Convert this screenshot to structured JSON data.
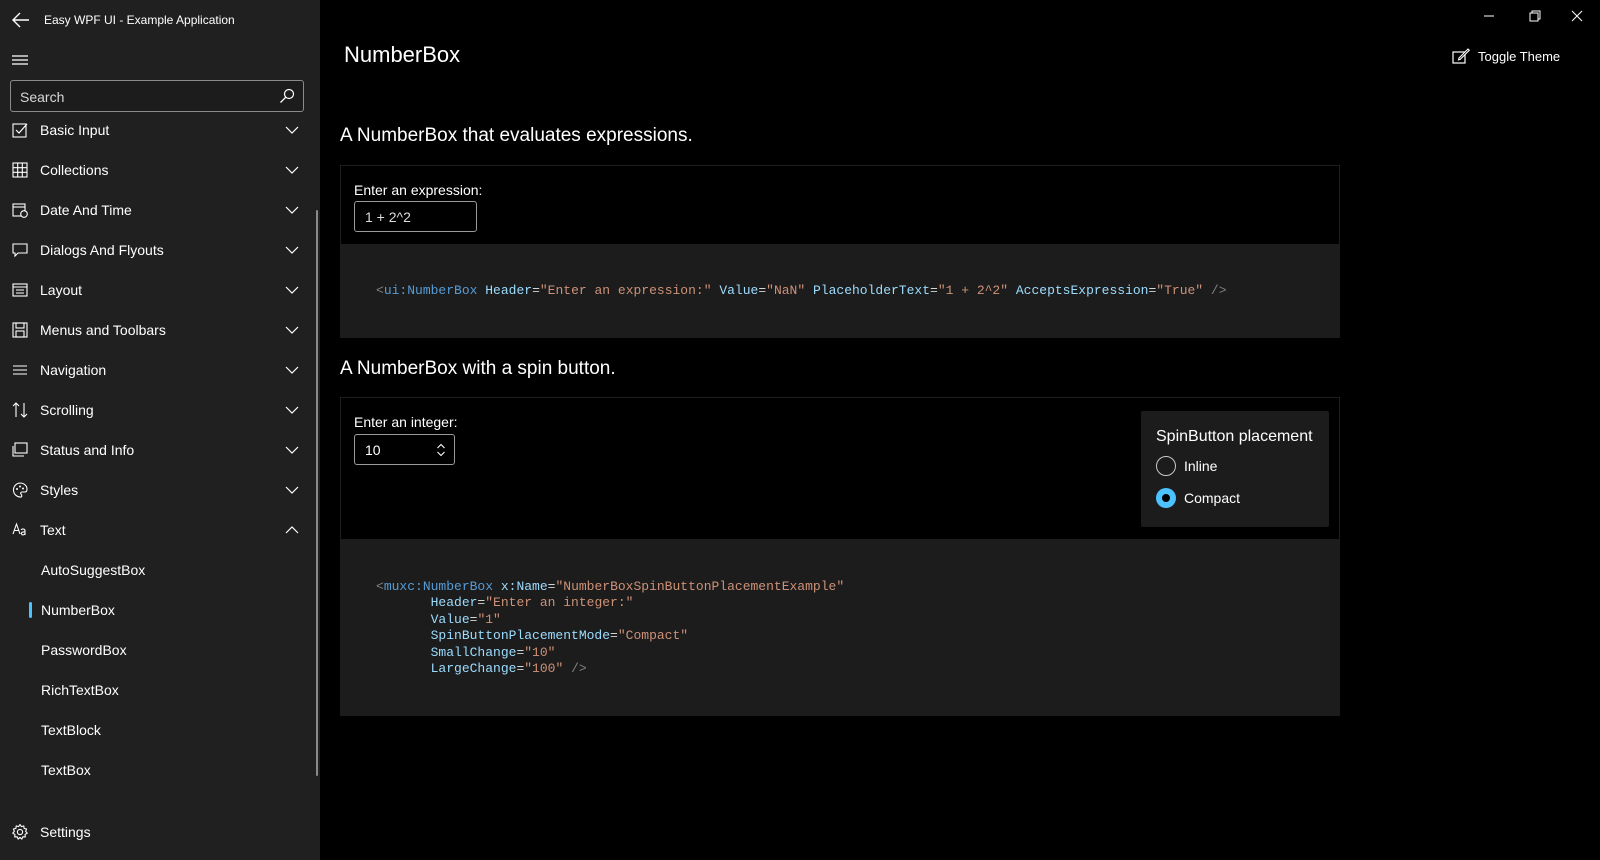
{
  "app": {
    "title": "Easy WPF UI - Example Application"
  },
  "search": {
    "placeholder": "Search"
  },
  "sidebar": {
    "items": [
      {
        "label": "Basic Input",
        "icon": "checkbox-icon",
        "expanded": false
      },
      {
        "label": "Collections",
        "icon": "grid-icon",
        "expanded": false
      },
      {
        "label": "Date And Time",
        "icon": "calendar-icon",
        "expanded": false
      },
      {
        "label": "Dialogs And Flyouts",
        "icon": "chat-icon",
        "expanded": false
      },
      {
        "label": "Layout",
        "icon": "layout-icon",
        "expanded": false
      },
      {
        "label": "Menus and Toolbars",
        "icon": "save-icon",
        "expanded": false
      },
      {
        "label": "Navigation",
        "icon": "list-icon",
        "expanded": false
      },
      {
        "label": "Scrolling",
        "icon": "arrows-icon",
        "expanded": false
      },
      {
        "label": "Status and Info",
        "icon": "status-icon",
        "expanded": false
      },
      {
        "label": "Styles",
        "icon": "palette-icon",
        "expanded": false
      },
      {
        "label": "Text",
        "icon": "text-icon",
        "expanded": true
      }
    ],
    "sub_items": [
      "AutoSuggestBox",
      "NumberBox",
      "PasswordBox",
      "RichTextBox",
      "TextBlock",
      "TextBox"
    ],
    "selected_sub_item": "NumberBox",
    "settings_label": "Settings"
  },
  "page": {
    "title": "NumberBox",
    "toggle_theme_label": "Toggle Theme"
  },
  "example1": {
    "title": "A NumberBox that evaluates expressions.",
    "field_label": "Enter an expression:",
    "placeholder": "1 + 2^2",
    "value": "",
    "code": [
      [
        [
          "t-gray",
          "<"
        ],
        [
          "t-tag",
          "ui:NumberBox"
        ],
        [
          "t-pun",
          " "
        ],
        [
          "t-attr",
          "Header"
        ],
        [
          "t-pun",
          "="
        ],
        [
          "t-str",
          "\"Enter an expression:\""
        ],
        [
          "t-pun",
          " "
        ],
        [
          "t-attr",
          "Value"
        ],
        [
          "t-pun",
          "="
        ],
        [
          "t-str",
          "\"NaN\""
        ],
        [
          "t-pun",
          " "
        ],
        [
          "t-attr",
          "PlaceholderText"
        ],
        [
          "t-pun",
          "="
        ],
        [
          "t-str",
          "\"1 + 2^2\""
        ],
        [
          "t-pun",
          " "
        ],
        [
          "t-attr",
          "AcceptsExpression"
        ],
        [
          "t-pun",
          "="
        ],
        [
          "t-str",
          "\"True\""
        ],
        [
          "t-pun",
          " "
        ],
        [
          "t-gray",
          "/>"
        ]
      ]
    ]
  },
  "example2": {
    "title": "A NumberBox with a spin button.",
    "field_label": "Enter an integer:",
    "value": "10",
    "spin_panel": {
      "header": "SpinButton placement",
      "options": [
        {
          "label": "Inline",
          "checked": false
        },
        {
          "label": "Compact",
          "checked": true
        }
      ]
    },
    "code": [
      [
        [
          "t-gray",
          "<"
        ],
        [
          "t-tag",
          "muxc:NumberBox"
        ],
        [
          "t-pun",
          " "
        ],
        [
          "t-attr",
          "x:Name"
        ],
        [
          "t-pun",
          "="
        ],
        [
          "t-str",
          "\"NumberBoxSpinButtonPlacementExample\""
        ]
      ],
      [
        [
          "t-pun",
          "       "
        ],
        [
          "t-attr",
          "Header"
        ],
        [
          "t-pun",
          "="
        ],
        [
          "t-str",
          "\"Enter an integer:\""
        ]
      ],
      [
        [
          "t-pun",
          "       "
        ],
        [
          "t-attr",
          "Value"
        ],
        [
          "t-pun",
          "="
        ],
        [
          "t-str",
          "\"1\""
        ]
      ],
      [
        [
          "t-pun",
          "       "
        ],
        [
          "t-attr",
          "SpinButtonPlacementMode"
        ],
        [
          "t-pun",
          "="
        ],
        [
          "t-str",
          "\"Compact\""
        ]
      ],
      [
        [
          "t-pun",
          "       "
        ],
        [
          "t-attr",
          "SmallChange"
        ],
        [
          "t-pun",
          "="
        ],
        [
          "t-str",
          "\"10\""
        ]
      ],
      [
        [
          "t-pun",
          "       "
        ],
        [
          "t-attr",
          "LargeChange"
        ],
        [
          "t-pun",
          "="
        ],
        [
          "t-str",
          "\"100\""
        ],
        [
          "t-pun",
          " "
        ],
        [
          "t-gray",
          "/>"
        ]
      ]
    ]
  },
  "colors": {
    "accent": "#4cc2ff",
    "sidebar_bg": "#202020",
    "code_bg": "#1c1c1c"
  }
}
